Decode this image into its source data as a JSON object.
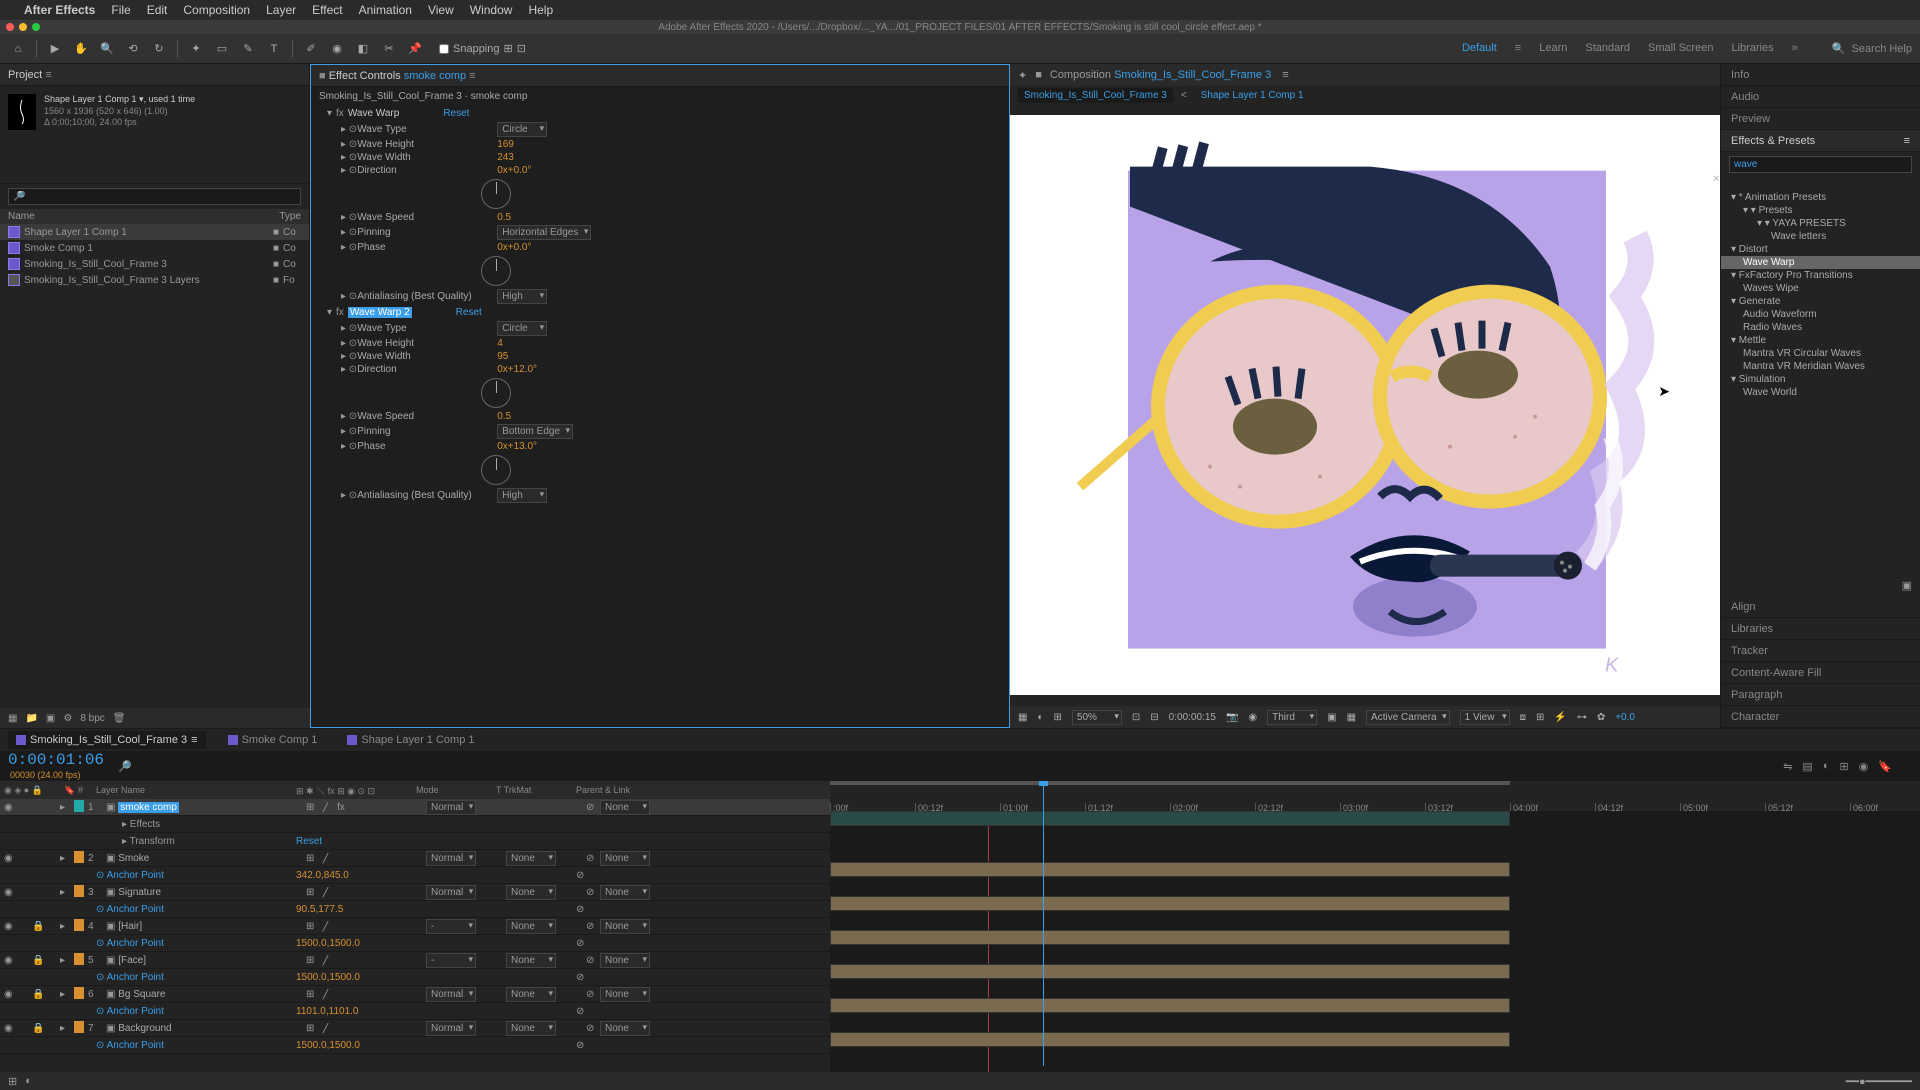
{
  "menubar": {
    "app": "After Effects",
    "items": [
      "File",
      "Edit",
      "Composition",
      "Layer",
      "Effect",
      "Animation",
      "View",
      "Window",
      "Help"
    ]
  },
  "titlebar": "Adobe After Effects 2020 - /Users/.../Dropbox/..._YA.../01_PROJECT FILES/01 AFTER EFFECTS/Smoking is still cool_circle effect.aep *",
  "toolbar": {
    "snapping": "Snapping"
  },
  "workspaces": {
    "items": [
      "Default",
      "Learn",
      "Standard",
      "Small Screen",
      "Libraries"
    ],
    "active": "Default",
    "search": "Search Help"
  },
  "project": {
    "title": "Project",
    "asset": {
      "name": "Shape Layer 1 Comp 1 ▾",
      "used": ", used 1 time",
      "dims": "1560 x 1936  (520 x 646) (1.00)",
      "dur": "Δ 0;00;10;00, 24.00 fps"
    },
    "cols": {
      "name": "Name",
      "type": "Type"
    },
    "items": [
      {
        "name": "Shape Layer 1 Comp 1",
        "type": "Co",
        "sel": true
      },
      {
        "name": "Smoke Comp 1",
        "type": "Co"
      },
      {
        "name": "Smoking_Is_Still_Cool_Frame 3",
        "type": "Co"
      },
      {
        "name": "Smoking_Is_Still_Cool_Frame 3 Layers",
        "type": "Fo"
      }
    ],
    "bpc": "8 bpc"
  },
  "effectControls": {
    "title": "Effect Controls",
    "for": "smoke comp",
    "breadcrumb": "Smoking_Is_Still_Cool_Frame 3 · smoke comp",
    "fx": [
      {
        "name": "Wave Warp",
        "reset": "Reset",
        "sel": false,
        "rows": [
          {
            "lbl": "Wave Type",
            "val": "Circle",
            "drop": true
          },
          {
            "lbl": "Wave Height",
            "val": "169"
          },
          {
            "lbl": "Wave Width",
            "val": "243"
          },
          {
            "lbl": "Direction",
            "val": "0x+0.0°",
            "dial": true
          },
          {
            "lbl": "Wave Speed",
            "val": "0.5"
          },
          {
            "lbl": "Pinning",
            "val": "Horizontal Edges",
            "drop": true
          },
          {
            "lbl": "Phase",
            "val": "0x+0.0°",
            "dial": true
          },
          {
            "lbl": "Antialiasing (Best Quality)",
            "val": "High",
            "drop": true
          }
        ]
      },
      {
        "name": "Wave Warp 2",
        "reset": "Reset",
        "sel": true,
        "rows": [
          {
            "lbl": "Wave Type",
            "val": "Circle",
            "drop": true
          },
          {
            "lbl": "Wave Height",
            "val": "4"
          },
          {
            "lbl": "Wave Width",
            "val": "95"
          },
          {
            "lbl": "Direction",
            "val": "0x+12.0°",
            "dial": true
          },
          {
            "lbl": "Wave Speed",
            "val": "0.5"
          },
          {
            "lbl": "Pinning",
            "val": "Bottom Edge",
            "drop": true
          },
          {
            "lbl": "Phase",
            "val": "0x+13.0°",
            "dial": true
          },
          {
            "lbl": "Antialiasing (Best Quality)",
            "val": "High",
            "drop": true
          }
        ]
      }
    ]
  },
  "composition": {
    "title": "Composition",
    "name": "Smoking_Is_Still_Cool_Frame 3",
    "subtabs": [
      "Smoking_Is_Still_Cool_Frame 3",
      "Shape Layer 1 Comp 1"
    ],
    "footer": {
      "zoom": "50%",
      "time": "0:00:00:15",
      "res": "Third",
      "camera": "Active Camera",
      "views": "1 View",
      "exp": "+0.0"
    }
  },
  "rightPanels": {
    "rows": [
      "Info",
      "Audio",
      "Preview"
    ],
    "ep": {
      "title": "Effects & Presets",
      "query": "wave",
      "tree": [
        {
          "cat": "▾ * Animation Presets",
          "items": [
            {
              "t": "▾ Presets",
              "sub": [
                {
                  "t": "▾ YAYA PRESETS",
                  "sub": [
                    {
                      "t": "Wave letters"
                    }
                  ]
                }
              ]
            }
          ]
        },
        {
          "cat": "▾ Distort",
          "items": [
            {
              "t": "Wave Warp",
              "hl": true
            }
          ]
        },
        {
          "cat": "▾ FxFactory Pro Transitions",
          "items": [
            {
              "t": "Waves Wipe"
            }
          ]
        },
        {
          "cat": "▾ Generate",
          "items": [
            {
              "t": "Audio Waveform"
            },
            {
              "t": "Radio Waves"
            }
          ]
        },
        {
          "cat": "▾ Mettle",
          "items": [
            {
              "t": "Mantra VR Circular Waves"
            },
            {
              "t": "Mantra VR Meridian Waves"
            }
          ]
        },
        {
          "cat": "▾ Simulation",
          "items": [
            {
              "t": "Wave World"
            }
          ]
        }
      ]
    },
    "bottom": [
      "Align",
      "Libraries",
      "Tracker",
      "Content-Aware Fill",
      "Paragraph",
      "Character"
    ]
  },
  "timeline": {
    "tabs": [
      {
        "name": "Smoking_Is_Still_Cool_Frame 3",
        "active": true
      },
      {
        "name": "Smoke Comp 1"
      },
      {
        "name": "Shape Layer 1 Comp 1"
      }
    ],
    "time": "0:00:01:06",
    "sub": "00030 (24.00 fps)",
    "cols": {
      "layerName": "Layer Name",
      "mode": "Mode",
      "trkMat": "T  TrkMat",
      "parent": "Parent & Link"
    },
    "rows": [
      {
        "n": "1",
        "color": "#2aa",
        "name": "smoke comp",
        "sel": true,
        "mode": "Normal",
        "trk": "",
        "parent": "None",
        "teal": true
      },
      {
        "sub": "Effects"
      },
      {
        "sub": "Transform",
        "reset": "Reset"
      },
      {
        "n": "2",
        "color": "#d89030",
        "name": "Smoke",
        "mode": "Normal",
        "trk": "None",
        "parent": "None"
      },
      {
        "anchor": "Anchor Point",
        "val": "342.0,845.0"
      },
      {
        "n": "3",
        "color": "#d89030",
        "name": "Signature",
        "mode": "Normal",
        "trk": "None",
        "parent": "None"
      },
      {
        "anchor": "Anchor Point",
        "val": "90.5,177.5"
      },
      {
        "n": "4",
        "color": "#d89030",
        "name": "[Hair]",
        "mode": "-",
        "trk": "None",
        "parent": "None"
      },
      {
        "anchor": "Anchor Point",
        "val": "1500.0,1500.0"
      },
      {
        "n": "5",
        "color": "#d89030",
        "name": "[Face]",
        "mode": "-",
        "trk": "None",
        "parent": "None"
      },
      {
        "anchor": "Anchor Point",
        "val": "1500.0,1500.0"
      },
      {
        "n": "6",
        "color": "#d89030",
        "name": "Bg Square",
        "mode": "Normal",
        "trk": "None",
        "parent": "None"
      },
      {
        "anchor": "Anchor Point",
        "val": "1101.0,1101.0"
      },
      {
        "n": "7",
        "color": "#d89030",
        "name": "Background",
        "mode": "Normal",
        "trk": "None",
        "parent": "None"
      },
      {
        "anchor": "Anchor Point",
        "val": "1500.0,1500.0"
      }
    ],
    "ruler": [
      ":00f",
      "00:12f",
      "01:00f",
      "01:12f",
      "02:00f",
      "02:12f",
      "03:00f",
      "03:12f",
      "04:00f",
      "04:12f",
      "05:00f",
      "05:12f",
      "06:00f"
    ]
  }
}
